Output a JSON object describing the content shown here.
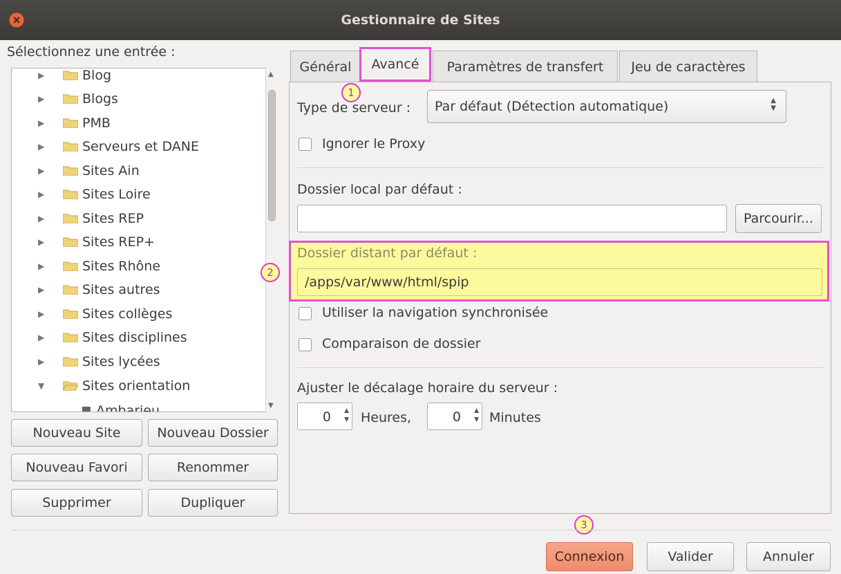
{
  "window": {
    "title": "Gestionnaire de Sites"
  },
  "left": {
    "label": "Sélectionnez une entrée :",
    "tree": [
      {
        "name": "Blog",
        "expanded": false
      },
      {
        "name": "Blogs",
        "expanded": false
      },
      {
        "name": "PMB",
        "expanded": false
      },
      {
        "name": "Serveurs et DANE",
        "expanded": false
      },
      {
        "name": "Sites Ain",
        "expanded": false
      },
      {
        "name": "Sites Loire",
        "expanded": false
      },
      {
        "name": "Sites REP",
        "expanded": false
      },
      {
        "name": "Sites REP+",
        "expanded": false
      },
      {
        "name": "Sites Rhône",
        "expanded": false
      },
      {
        "name": "Sites autres",
        "expanded": false
      },
      {
        "name": "Sites collèges",
        "expanded": false
      },
      {
        "name": "Sites disciplines",
        "expanded": false
      },
      {
        "name": "Sites lycées",
        "expanded": false
      },
      {
        "name": "Sites orientation",
        "expanded": true
      }
    ],
    "partial_child": "Ambarieu",
    "buttons": {
      "new_site": "Nouveau Site",
      "new_folder": "Nouveau Dossier",
      "new_bookmark": "Nouveau Favori",
      "rename": "Renommer",
      "delete": "Supprimer",
      "duplicate": "Dupliquer"
    }
  },
  "tabs": [
    {
      "label": "Général",
      "active": false
    },
    {
      "label": "Avancé",
      "active": true
    },
    {
      "label": "Paramètres de transfert",
      "active": false
    },
    {
      "label": "Jeu de caractères",
      "active": false
    }
  ],
  "advanced": {
    "server_type_label": "Type de serveur :",
    "server_type_value": "Par défaut (Détection automatique)",
    "ignore_proxy_label": "Ignorer le Proxy",
    "ignore_proxy_checked": false,
    "local_dir_label": "Dossier local par défaut :",
    "local_dir_value": "",
    "browse_label": "Parcourir...",
    "remote_dir_label": "Dossier distant par défaut :",
    "remote_dir_value": "/apps/var/www/html/spip",
    "sync_nav_label": "Utiliser la navigation synchronisée",
    "sync_nav_checked": false,
    "dir_compare_label": "Comparaison de dossier",
    "dir_compare_checked": false,
    "tz_label": "Ajuster le décalage horaire du serveur :",
    "hours_value": "0",
    "hours_label": "Heures,",
    "minutes_value": "0",
    "minutes_label": "Minutes"
  },
  "annotations": [
    "1",
    "2",
    "3"
  ],
  "footer": {
    "connect": "Connexion",
    "ok": "Valider",
    "cancel": "Annuler"
  },
  "colors": {
    "highlight_fill": "#fbfa9c",
    "highlight_border": "#e64fd2",
    "connect_button": "#f39a7b",
    "titlebar": "#3f3e3a",
    "close_button": "#e4683b"
  }
}
